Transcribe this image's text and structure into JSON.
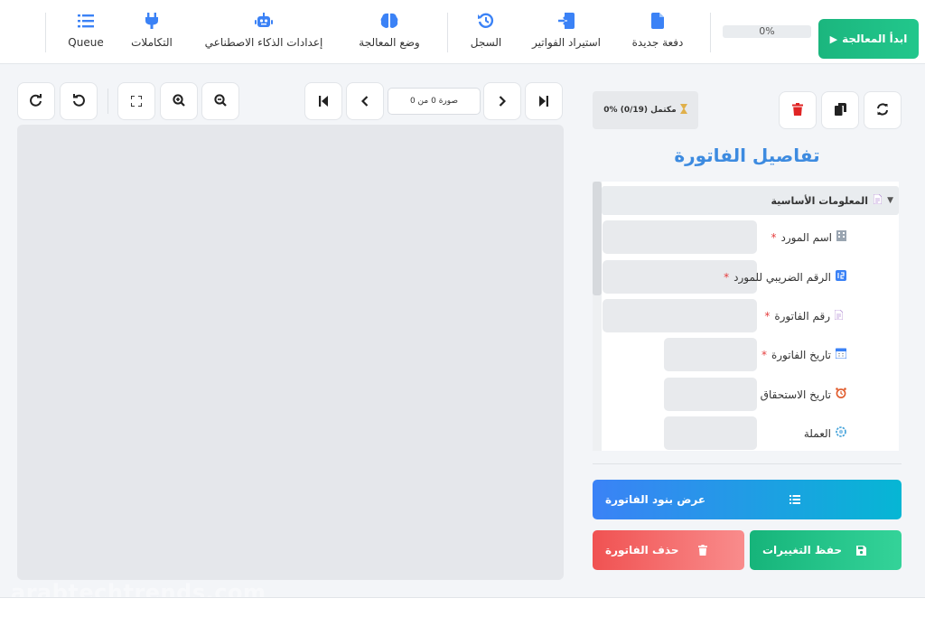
{
  "toolbar": {
    "start_label": "ابدأ المعالجة",
    "progress": "0%",
    "items": [
      {
        "label": "دفعة جديدة",
        "icon": "file-icon"
      },
      {
        "label": "استيراد الفواتير",
        "icon": "import-icon"
      },
      {
        "label": "السجل",
        "icon": "history-icon"
      },
      {
        "label": "وضع المعالجة",
        "icon": "brain-icon"
      },
      {
        "label": "إعدادات الذكاء الاصطناعي",
        "icon": "robot-icon"
      },
      {
        "label": "التكاملات",
        "icon": "plug-icon"
      },
      {
        "label": "Queue",
        "icon": "list-icon"
      }
    ],
    "accent": "#3b82f6"
  },
  "viewer": {
    "page_indicator": "صورة 0 من 0",
    "tools": [
      "rotate-right-icon",
      "rotate-left-icon",
      "fit-screen-icon",
      "zoom-in-icon",
      "zoom-out-icon",
      "first-page-icon",
      "prev-page-icon",
      "next-page-icon",
      "last-page-icon"
    ],
    "watermark": "arabtechtrends.com"
  },
  "panel": {
    "status": "0% مكتمل (0/19)",
    "title": "تفاصيل الفاتورة",
    "section_title": "المعلومات الأساسية",
    "fields": [
      {
        "label": "اسم المورد",
        "required": "*",
        "icon": "building-icon",
        "value": ""
      },
      {
        "label": "الرقم الضريبي للمورد",
        "required": "*",
        "icon": "numbers-icon",
        "value": ""
      },
      {
        "label": "رقم الفاتورة",
        "required": "*",
        "icon": "document-icon",
        "value": ""
      },
      {
        "label": "تاريخ الفاتورة",
        "required": "*",
        "icon": "calendar-icon",
        "value": ""
      },
      {
        "label": "تاريخ الاستحقاق",
        "required": "",
        "icon": "alarm-clock-icon",
        "value": ""
      },
      {
        "label": "العملة",
        "required": "",
        "icon": "coin-icon",
        "value": ""
      }
    ],
    "show_items_label": "عرض بنود الفاتورة",
    "save_label": "حفظ التغييرات",
    "delete_label": "حذف الفاتورة"
  },
  "colors": {
    "success": "#22c78c",
    "danger": "#f05252",
    "info": "#3b82f6",
    "title": "#3d8be0"
  }
}
